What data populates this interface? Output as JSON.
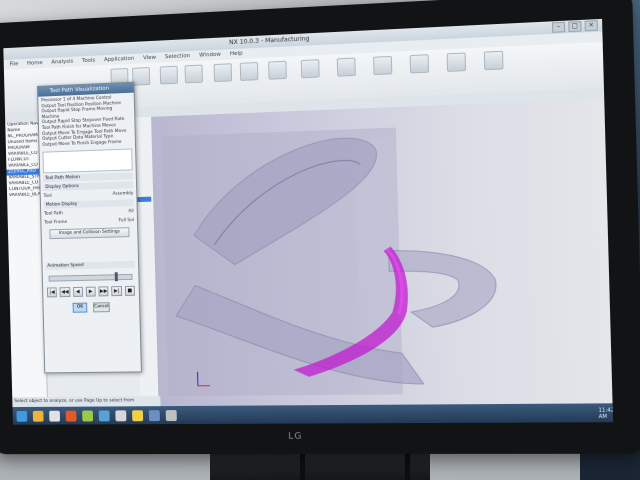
{
  "app": {
    "window_title": "NX 10.0.3 - Manufacturing",
    "window_buttons": [
      "–",
      "□",
      "×"
    ]
  },
  "menu": [
    "File",
    "Home",
    "Analysis",
    "Tools",
    "Application",
    "View",
    "Selection",
    "Window",
    "Help"
  ],
  "navigator": {
    "title": "Operation Navigator - Program",
    "rows": [
      "Name",
      "NC_PROGRAM",
      "Unused Items",
      "PROGRAM",
      "VARIABLE_CO",
      "FLOWCUT",
      "VARIABLE_CO",
      "ZLEVEL_PRO",
      "VARIABLE_STR",
      "VARIABLE_CO",
      "CONTOUR_PRO",
      "VARIABLE_BLA"
    ],
    "selected_index": 7
  },
  "dialog": {
    "title": "Tool Path Visualization",
    "message_lines": [
      "Processor 1 of 4 Machine Control",
      "Output Tool Position Position Machine",
      "Output Rapid Stop Frame Moving Machine",
      "Output Rapid Stop Stepover Feed Rate",
      "Tool Path Finish for Machine Moves",
      "Output Move To Engage Tool Path Move",
      "Output Cutter Data Material Type",
      "Output Move To Finish Engage Frame"
    ],
    "section_tool": "Tool Path Motion",
    "display_options": "Display Options",
    "field_tool": "Tool",
    "field_tool_value": "Assembly",
    "section_motion": "Motion Display",
    "field_tool_path": "Tool Path",
    "field_tool_path_value": "All",
    "field_tool_frame": "Tool Frame",
    "field_tool_frame_value": "Full Sol",
    "button_settings": "Image and Collision Settings",
    "animation_speed": "Animation Speed",
    "animation_speed_level": 0.8,
    "play_buttons": [
      "|◀",
      "◀◀",
      "◀",
      "▶",
      "▶▶",
      "▶|",
      "■"
    ],
    "ok_label": "OK",
    "cancel_label": "Cancel"
  },
  "status": {
    "text": "Select object to analyze, or use Page Up to select from"
  },
  "taskbar": {
    "clock": "11:42 AM"
  },
  "monitor": {
    "brand": "LG"
  },
  "colors": {
    "toolpath": "#c21bd0",
    "selection": "#3b7ddb",
    "part": "#9a9ab8"
  }
}
